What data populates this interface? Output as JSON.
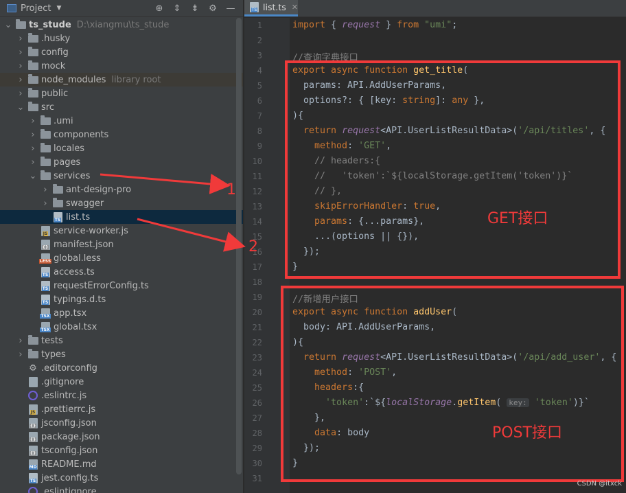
{
  "project_header": {
    "title": "Project",
    "icons": [
      "target-icon",
      "expand-icon",
      "collapse-icon",
      "gear-icon",
      "minimize-icon"
    ]
  },
  "tree": [
    {
      "label": "ts_stude",
      "extra": "D:\\xiangmu\\ts_stude",
      "level": 0,
      "kind": "folder",
      "expanded": true,
      "bold": true
    },
    {
      "label": ".husky",
      "level": 1,
      "kind": "folder"
    },
    {
      "label": "config",
      "level": 1,
      "kind": "folder"
    },
    {
      "label": "mock",
      "level": 1,
      "kind": "folder"
    },
    {
      "label": "node_modules",
      "extra": "library root",
      "level": 1,
      "kind": "folder",
      "highlight": true
    },
    {
      "label": "public",
      "level": 1,
      "kind": "folder"
    },
    {
      "label": "src",
      "level": 1,
      "kind": "folder",
      "expanded": true
    },
    {
      "label": ".umi",
      "level": 2,
      "kind": "folder"
    },
    {
      "label": "components",
      "level": 2,
      "kind": "folder"
    },
    {
      "label": "locales",
      "level": 2,
      "kind": "folder"
    },
    {
      "label": "pages",
      "level": 2,
      "kind": "folder"
    },
    {
      "label": "services",
      "level": 2,
      "kind": "folder",
      "expanded": true
    },
    {
      "label": "ant-design-pro",
      "level": 3,
      "kind": "folder"
    },
    {
      "label": "swagger",
      "level": 3,
      "kind": "folder"
    },
    {
      "label": "list.ts",
      "level": 3,
      "kind": "ts",
      "file": true,
      "selected": true
    },
    {
      "label": "service-worker.js",
      "level": 2,
      "kind": "js",
      "file": true
    },
    {
      "label": "manifest.json",
      "level": 2,
      "kind": "json",
      "file": true
    },
    {
      "label": "global.less",
      "level": 2,
      "kind": "less",
      "file": true
    },
    {
      "label": "access.ts",
      "level": 2,
      "kind": "ts",
      "file": true
    },
    {
      "label": "requestErrorConfig.ts",
      "level": 2,
      "kind": "ts",
      "file": true
    },
    {
      "label": "typings.d.ts",
      "level": 2,
      "kind": "ts",
      "file": true
    },
    {
      "label": "app.tsx",
      "level": 2,
      "kind": "tsx",
      "file": true
    },
    {
      "label": "global.tsx",
      "level": 2,
      "kind": "tsx",
      "file": true
    },
    {
      "label": "tests",
      "level": 1,
      "kind": "folder"
    },
    {
      "label": "types",
      "level": 1,
      "kind": "folder"
    },
    {
      "label": ".editorconfig",
      "level": 1,
      "kind": "gear",
      "file": true
    },
    {
      "label": ".gitignore",
      "level": 1,
      "kind": "plain",
      "file": true
    },
    {
      "label": ".eslintrc.js",
      "level": 1,
      "kind": "ring",
      "file": true
    },
    {
      "label": ".prettierrc.js",
      "level": 1,
      "kind": "js",
      "file": true
    },
    {
      "label": "jsconfig.json",
      "level": 1,
      "kind": "json",
      "file": true
    },
    {
      "label": "package.json",
      "level": 1,
      "kind": "json",
      "file": true
    },
    {
      "label": "tsconfig.json",
      "level": 1,
      "kind": "json",
      "file": true
    },
    {
      "label": "README.md",
      "level": 1,
      "kind": "md",
      "file": true
    },
    {
      "label": "jest.config.ts",
      "level": 1,
      "kind": "ts",
      "file": true
    },
    {
      "label": ".eslintignore",
      "level": 1,
      "kind": "ring",
      "file": true
    }
  ],
  "editor_tab": {
    "label": "list.ts",
    "icon": "ts-file-icon"
  },
  "code_lines": [
    [
      [
        "k",
        "import "
      ],
      [
        "p",
        "{ "
      ],
      [
        "i",
        "request"
      ],
      [
        "p",
        " } "
      ],
      [
        "k",
        "from "
      ],
      [
        "s",
        "\"umi\""
      ],
      [
        "p",
        ";"
      ]
    ],
    [],
    [
      [
        "c",
        "//查询字典接口"
      ]
    ],
    [
      [
        "k",
        "export async function "
      ],
      [
        "f",
        "get_title"
      ],
      [
        "p",
        "("
      ]
    ],
    [
      [
        "p",
        "  params: API.AddUserParams,"
      ]
    ],
    [
      [
        "p",
        "  options?: { [key: "
      ],
      [
        "k",
        "string"
      ],
      [
        "p",
        "]: "
      ],
      [
        "k",
        "any"
      ],
      [
        "p",
        " },"
      ]
    ],
    [
      [
        "p",
        "){"
      ]
    ],
    [
      [
        "k",
        "  return "
      ],
      [
        "i",
        "request"
      ],
      [
        "p",
        "<API.UserListResultData>("
      ],
      [
        "s",
        "'/api/titles'"
      ],
      [
        "p",
        ", {"
      ]
    ],
    [
      [
        "p",
        "    "
      ],
      [
        "t",
        "method"
      ],
      [
        "p",
        ": "
      ],
      [
        "s",
        "'GET'"
      ],
      [
        "p",
        ","
      ]
    ],
    [
      [
        "c",
        "    // headers:{"
      ]
    ],
    [
      [
        "c",
        "    //   'token':`${localStorage.getItem('token')}`"
      ]
    ],
    [
      [
        "c",
        "    // },"
      ]
    ],
    [
      [
        "p",
        "    "
      ],
      [
        "t",
        "skipErrorHandler"
      ],
      [
        "p",
        ": "
      ],
      [
        "k",
        "true"
      ],
      [
        "p",
        ","
      ]
    ],
    [
      [
        "p",
        "    "
      ],
      [
        "t",
        "params"
      ],
      [
        "p",
        ": {...params},"
      ]
    ],
    [
      [
        "p",
        "    ...(options || {}),"
      ]
    ],
    [
      [
        "p",
        "  });"
      ]
    ],
    [
      [
        "p",
        "}"
      ]
    ],
    [],
    [
      [
        "c",
        "//新增用户接口"
      ]
    ],
    [
      [
        "k",
        "export async function "
      ],
      [
        "f",
        "addUser"
      ],
      [
        "p",
        "("
      ]
    ],
    [
      [
        "p",
        "  body: API.AddUserParams,"
      ]
    ],
    [
      [
        "p",
        "){"
      ]
    ],
    [
      [
        "k",
        "  return "
      ],
      [
        "i",
        "request"
      ],
      [
        "p",
        "<API.UserListResultData>("
      ],
      [
        "s",
        "'/api/add_user'"
      ],
      [
        "p",
        ", {"
      ]
    ],
    [
      [
        "p",
        "    "
      ],
      [
        "t",
        "method"
      ],
      [
        "p",
        ": "
      ],
      [
        "s",
        "'POST'"
      ],
      [
        "p",
        ","
      ]
    ],
    [
      [
        "p",
        "    "
      ],
      [
        "t",
        "headers"
      ],
      [
        "p",
        ":{"
      ]
    ],
    [
      [
        "p",
        "      "
      ],
      [
        "s",
        "'token'"
      ],
      [
        "p",
        ":`${"
      ],
      [
        "i",
        "localStorage"
      ],
      [
        "p",
        "."
      ],
      [
        "f",
        "getItem"
      ],
      [
        "p",
        "( "
      ],
      [
        "h",
        "key:"
      ],
      [
        "s",
        " 'token'"
      ],
      [
        "p",
        ")}`"
      ]
    ],
    [
      [
        "p",
        "    },"
      ]
    ],
    [
      [
        "p",
        "    "
      ],
      [
        "t",
        "data"
      ],
      [
        "p",
        ": body"
      ]
    ],
    [
      [
        "p",
        "  });"
      ]
    ],
    [
      [
        "p",
        "}"
      ]
    ],
    []
  ],
  "line_numbers": [
    "1",
    "2",
    "3",
    "4",
    "5",
    "6",
    "7",
    "8",
    "9",
    "10",
    "11",
    "12",
    "13",
    "14",
    "15",
    "16",
    "17",
    "18",
    "19",
    "20",
    "21",
    "22",
    "23",
    "24",
    "25",
    "26",
    "27",
    "28",
    "29",
    "30",
    "31"
  ],
  "annotations": {
    "marker_1": "1",
    "marker_2": "2",
    "get_label": "GET接口",
    "post_label": "POST接口",
    "watermark": "CSDN @itxck"
  },
  "colors": {
    "red": "#f03a3a",
    "keyword": "#cc7832",
    "string": "#6a8759",
    "function": "#ffc66d",
    "comment": "#808080"
  }
}
